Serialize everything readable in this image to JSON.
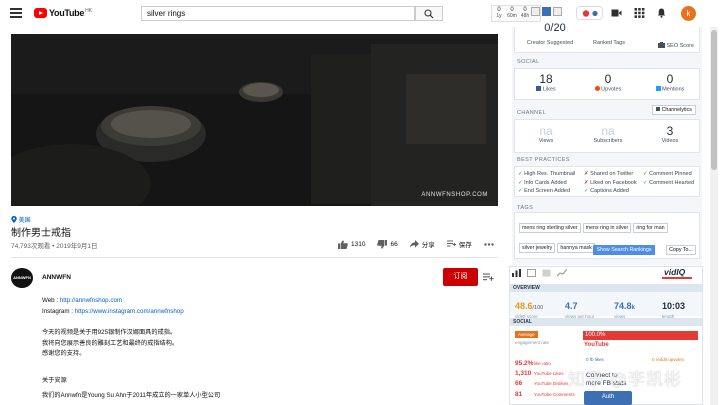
{
  "header": {
    "logo_word": "YouTube",
    "logo_region": "HK",
    "search_query": "silver rings",
    "ext_stats": [
      {
        "value": "0",
        "label": "1y"
      },
      {
        "value": "0",
        "label": "60m"
      },
      {
        "value": "0",
        "label": "48h"
      }
    ],
    "avatar_letter": "k"
  },
  "video": {
    "watermark": "ANNWFNSHOP.COM",
    "location": "美国",
    "title": "制作男士戒指",
    "meta": "74,793次观看 • 2019年9月1日",
    "likes": "1310",
    "dislikes": "66",
    "share_label": "分享",
    "save_label": "保存"
  },
  "channel": {
    "avatar_text": "ANNWFN",
    "name": "ANNWFN",
    "subscribe_label": "订阅"
  },
  "description": {
    "web_prefix": "Web : ",
    "web_url": "http://annwfnshop.com",
    "ig_prefix": "Instagram : ",
    "ig_url": "https://www.instagram.com/annwfnshop",
    "p1": "今天的视频是关于用925银制作汉娜面具的戒指。",
    "p2": "我将向您展示善良的雕刻工艺和最终的戒指结构。",
    "p3": "感谢您的支持。",
    "about_title": "关于安源",
    "about_text": "我们的Annwfn是Young Su Ahn于2011年成立的一家单人小型公司"
  },
  "seo_panel": {
    "top_partial": "0/20",
    "creator_suggested": "Creator Suggested",
    "ranked_tags": "Ranked Tags",
    "seo_score": "SEO Score",
    "social_title": "SOCIAL",
    "social": [
      {
        "value": "18",
        "label": "Likes"
      },
      {
        "value": "0",
        "label": "Upvotes"
      },
      {
        "value": "0",
        "label": "Mentions"
      }
    ],
    "channel_title": "CHANNEL",
    "channelytics": "Channelytics",
    "channel_stats": [
      {
        "value": "na",
        "label": "Views"
      },
      {
        "value": "na",
        "label": "Subscribers"
      },
      {
        "value": "3",
        "label": "Videos"
      }
    ],
    "best_title": "BEST PRACTICES",
    "best_col1": [
      {
        "mark": "✓",
        "ok": true,
        "text": "High Res. Thumbnail"
      },
      {
        "mark": "✓",
        "ok": true,
        "text": "Info Cards Added"
      },
      {
        "mark": "✓",
        "ok": true,
        "text": "End Screen Added"
      }
    ],
    "best_col2": [
      {
        "mark": "✗",
        "ok": false,
        "text": "Shared on Twitter"
      },
      {
        "mark": "✗",
        "ok": false,
        "text": "Liked on Facebook"
      },
      {
        "mark": "✓",
        "ok": true,
        "text": "Captions Added"
      }
    ],
    "best_col3": [
      {
        "mark": "✓",
        "ok": true,
        "text": "Comment Pinned"
      },
      {
        "mark": "✓",
        "ok": true,
        "text": "Comment Hearted"
      }
    ],
    "tags_title": "TAGS",
    "tags": [
      "mens ring sterling silver",
      "mens ring in silver",
      "ring for man",
      "silver jewelry",
      "hannya mask"
    ],
    "show_rankings": "Show Search Rankings",
    "copy_to": "Copy To..."
  },
  "vidiq": {
    "brand": "vidIQ",
    "overview_title": "OVERVIEW",
    "overview": [
      {
        "value": "48.6",
        "suffix": "/100",
        "label": "vidIQ score",
        "color": "#e59a1a"
      },
      {
        "value": "4.7",
        "suffix": "",
        "label": "views per hour",
        "color": "#3d6fb4"
      },
      {
        "value": "74.8",
        "suffix": "k",
        "label": "views",
        "color": "#3d6fb4"
      },
      {
        "value": "10:03",
        "suffix": "",
        "label": "length",
        "color": "#1f2b38"
      }
    ],
    "social_title": "SOCIAL",
    "engagement_badge": "Average",
    "engagement_label": "engagement rate",
    "youtube_pct": "100.0%",
    "youtube_label": "YouTube",
    "rows": [
      {
        "value": "95.2%",
        "label": "like ratio"
      },
      {
        "value": "1,310",
        "label": "YouTube Likes"
      },
      {
        "value": "66",
        "label": "YouTube Dislikes"
      },
      {
        "value": "81",
        "label": "YouTube Comments"
      }
    ],
    "fb_likes": "0 fb likes",
    "reddit": "0 reddit upvotes",
    "connect_line1": "Connect to",
    "connect_line2": "more FB stats",
    "auth_label": "Auth"
  },
  "overlay_watermark": "知乎 @李凯彬"
}
